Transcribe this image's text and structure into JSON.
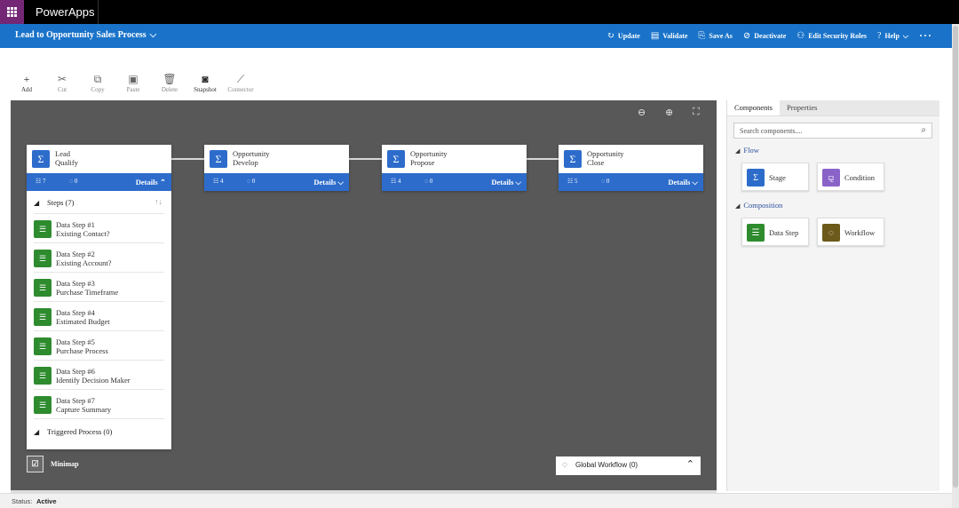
{
  "app": {
    "name": "PowerApps"
  },
  "command_bar": {
    "title": "Lead to Opportunity Sales Process",
    "actions": [
      {
        "label": "Update",
        "icon": "refresh-icon"
      },
      {
        "label": "Validate",
        "icon": "clipboard-icon"
      },
      {
        "label": "Save As",
        "icon": "save-icon"
      },
      {
        "label": "Deactivate",
        "icon": "deactivate-icon"
      },
      {
        "label": "Edit Security Roles",
        "icon": "security-roles-icon"
      },
      {
        "label": "Help",
        "icon": "help-icon"
      }
    ]
  },
  "toolbar": {
    "tools": [
      {
        "label": "Add",
        "icon": "plus-icon",
        "enabled": true
      },
      {
        "label": "Cut",
        "icon": "scissors-icon",
        "enabled": false
      },
      {
        "label": "Copy",
        "icon": "copy-icon",
        "enabled": false
      },
      {
        "label": "Paste",
        "icon": "paste-icon",
        "enabled": false
      },
      {
        "label": "Delete",
        "icon": "trash-icon",
        "enabled": false
      },
      {
        "label": "Snapshot",
        "icon": "camera-icon",
        "enabled": true
      },
      {
        "label": "Connector",
        "icon": "connector-icon",
        "enabled": false
      }
    ]
  },
  "stages": [
    {
      "entity": "Lead",
      "name": "Qualify",
      "steps_count": "7",
      "workflows_count": "0",
      "details": "Details",
      "expanded": true
    },
    {
      "entity": "Opportunity",
      "name": "Develop",
      "steps_count": "4",
      "workflows_count": "0",
      "details": "Details",
      "expanded": false
    },
    {
      "entity": "Opportunity",
      "name": "Propose",
      "steps_count": "4",
      "workflows_count": "0",
      "details": "Details",
      "expanded": false
    },
    {
      "entity": "Opportunity",
      "name": "Close",
      "steps_count": "5",
      "workflows_count": "0",
      "details": "Details",
      "expanded": false
    }
  ],
  "expanded_stage": {
    "steps_label": "Steps (7)",
    "steps": [
      {
        "title": "Data Step #1",
        "field": "Existing Contact?"
      },
      {
        "title": "Data Step #2",
        "field": "Existing Account?"
      },
      {
        "title": "Data Step #3",
        "field": "Purchase Timeframe"
      },
      {
        "title": "Data Step #4",
        "field": "Estimated Budget"
      },
      {
        "title": "Data Step #5",
        "field": "Purchase Process"
      },
      {
        "title": "Data Step #6",
        "field": "Identify Decision Maker"
      },
      {
        "title": "Data Step #7",
        "field": "Capture Summary"
      }
    ],
    "triggered_label": "Triggered Process (0)"
  },
  "canvas": {
    "minimap_label": "Minimap",
    "global_workflow_label": "Global Workflow (0)"
  },
  "right_panel": {
    "tabs": [
      "Components",
      "Properties"
    ],
    "active_tab": "Components",
    "search_placeholder": "Search components....",
    "groups": [
      {
        "name": "Flow",
        "items": [
          {
            "label": "Stage",
            "color": "#2d6ccb",
            "icon": "stage-icon"
          },
          {
            "label": "Condition",
            "color": "#8a63c9",
            "icon": "condition-icon"
          }
        ]
      },
      {
        "name": "Composition",
        "items": [
          {
            "label": "Data Step",
            "color": "#2e8b2e",
            "icon": "data-step-icon"
          },
          {
            "label": "Workflow",
            "color": "#6b5a1a",
            "icon": "workflow-icon"
          }
        ]
      }
    ]
  },
  "status": {
    "label": "Status:",
    "value": "Active"
  },
  "colors": {
    "app_bar": "#000000",
    "waffle": "#742774",
    "command_bar": "#1a73c9",
    "canvas": "#585858",
    "stage": "#2d6ccb",
    "step": "#2e8b2e"
  }
}
